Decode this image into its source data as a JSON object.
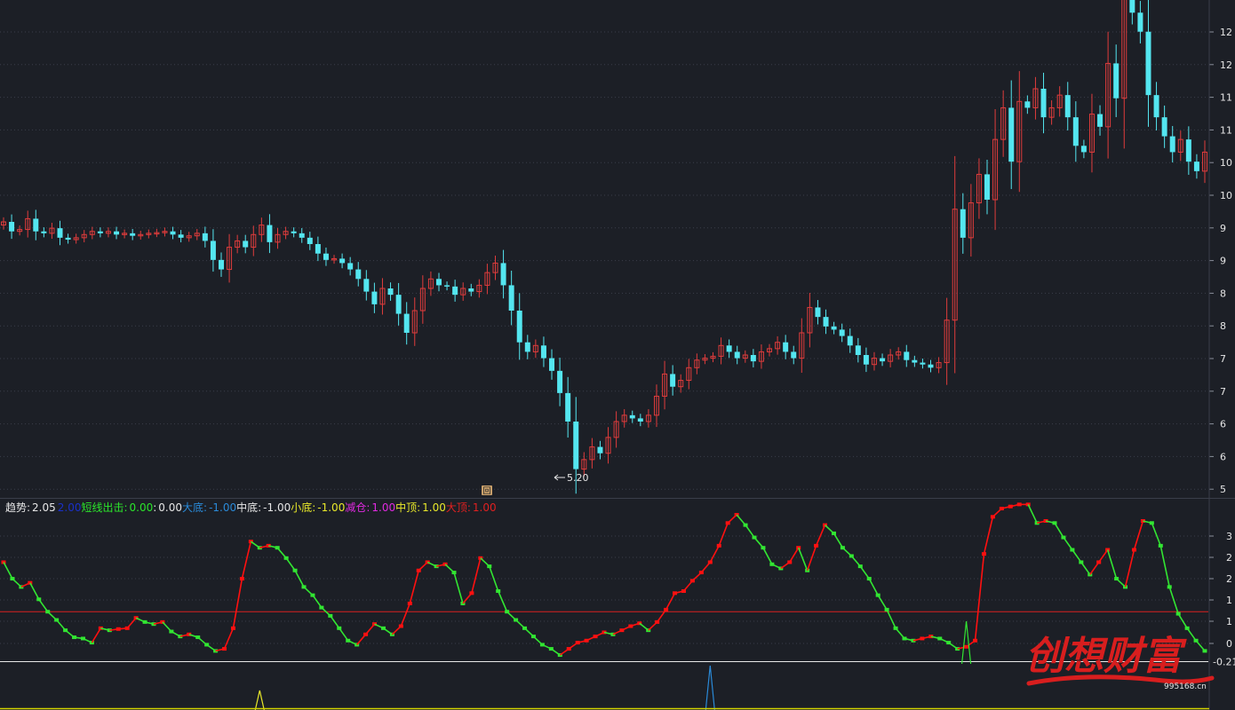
{
  "price_axis": {
    "ticks": [
      "12",
      "12",
      "11",
      "11",
      "10",
      "10",
      "9",
      "9",
      "8",
      "8",
      "7",
      "7",
      "6",
      "6",
      "5"
    ]
  },
  "low_marker": "5.20",
  "marker_glyph": "回",
  "indicator_bar": [
    {
      "label": "趋势:",
      "value": "2.05",
      "label_color": "#e6e6e6",
      "value_color": "#e6e6e6"
    },
    {
      "label": "",
      "value": "2.00",
      "label_color": "#1a30c8",
      "value_color": "#1a30c8"
    },
    {
      "label": "短线出击:",
      "value": "0.00",
      "label_color": "#2be52b",
      "value_color": "#2be52b"
    },
    {
      "label": ":",
      "value": "0.00",
      "label_color": "#e6e6e6",
      "value_color": "#e6e6e6"
    },
    {
      "label": "大底:",
      "value": "-1.00",
      "label_color": "#2a8ad8",
      "value_color": "#2a8ad8"
    },
    {
      "label": "中底:",
      "value": "-1.00",
      "label_color": "#e6e6e6",
      "value_color": "#e6e6e6"
    },
    {
      "label": "小底:",
      "value": "-1.00",
      "label_color": "#e8e82a",
      "value_color": "#e8e82a"
    },
    {
      "label": "减仓:",
      "value": "1.00",
      "label_color": "#e02ae0",
      "value_color": "#e02ae0"
    },
    {
      "label": "中顶:",
      "value": "1.00",
      "label_color": "#e8e82a",
      "value_color": "#e8e82a"
    },
    {
      "label": "大顶:",
      "value": "1.00",
      "label_color": "#e02020",
      "value_color": "#e02020"
    }
  ],
  "indicator_axis": {
    "ticks": [
      "3",
      "2",
      "2",
      "1",
      "1",
      "0"
    ],
    "current_value": "-0.21"
  },
  "watermark": {
    "text": "创想财富",
    "site": "995168.cn"
  },
  "colors": {
    "background": "#1c1f26",
    "up": "#e03c3c",
    "down": "#54e6f0",
    "rising": "#ff1010",
    "falling": "#32e632",
    "refline": "#d92020",
    "zeroline": "#e8e8e8",
    "grid": "#3a3e4a"
  },
  "chart_data": [
    {
      "type": "candlestick",
      "ylim": [
        4.9,
        12.6
      ],
      "close": [
        9.1,
        8.95,
        8.98,
        9.15,
        8.95,
        8.92,
        9.0,
        8.85,
        8.82,
        8.85,
        8.9,
        8.95,
        8.92,
        8.95,
        8.9,
        8.92,
        8.88,
        8.9,
        8.92,
        8.93,
        8.95,
        8.9,
        8.85,
        8.88,
        8.92,
        8.8,
        8.5,
        8.35,
        8.7,
        8.8,
        8.7,
        8.9,
        9.05,
        8.78,
        8.9,
        8.95,
        8.92,
        8.85,
        8.75,
        8.6,
        8.5,
        8.52,
        8.45,
        8.35,
        8.2,
        8.0,
        7.8,
        8.05,
        7.95,
        7.65,
        7.35,
        7.7,
        8.05,
        8.2,
        8.1,
        8.08,
        7.95,
        8.05,
        8.0,
        8.1,
        8.3,
        8.45,
        8.1,
        7.7,
        7.2,
        7.05,
        7.15,
        6.95,
        6.75,
        6.4,
        5.95,
        5.2,
        5.35,
        5.55,
        5.45,
        5.7,
        5.95,
        6.05,
        6.0,
        5.95,
        6.05,
        6.35,
        6.7,
        6.5,
        6.6,
        6.8,
        6.92,
        6.95,
        6.98,
        7.15,
        7.05,
        6.95,
        7.0,
        6.9,
        7.05,
        7.1,
        7.2,
        7.05,
        6.95,
        7.35,
        7.75,
        7.6,
        7.45,
        7.4,
        7.3,
        7.15,
        7.0,
        6.85,
        6.95,
        6.9,
        7.0,
        7.05,
        6.92,
        6.88,
        6.85,
        6.8,
        6.88,
        7.55,
        9.3,
        8.85,
        9.4,
        9.85,
        9.45,
        10.4,
        10.9,
        10.05,
        11.0,
        10.9,
        11.2,
        10.75,
        10.9,
        11.1,
        10.75,
        10.3,
        10.2,
        10.8,
        10.6,
        11.6,
        11.05,
        12.7,
        12.4,
        12.1,
        11.1,
        10.75,
        10.45,
        10.2,
        10.4,
        10.05,
        9.9,
        10.2
      ]
    },
    {
      "type": "line",
      "name": "趋势",
      "ylim": [
        -0.35,
        3.35
      ],
      "current": 2.05,
      "reference_lines": [
        1.0,
        -0.21
      ],
      "values": [
        2.2,
        1.8,
        1.6,
        1.7,
        1.3,
        1.0,
        0.8,
        0.55,
        0.38,
        0.35,
        0.25,
        0.6,
        0.55,
        0.58,
        0.6,
        0.85,
        0.75,
        0.7,
        0.75,
        0.52,
        0.4,
        0.45,
        0.38,
        0.2,
        0.05,
        0.1,
        0.6,
        1.8,
        2.7,
        2.55,
        2.6,
        2.55,
        2.3,
        2.0,
        1.6,
        1.4,
        1.1,
        0.9,
        0.6,
        0.3,
        0.2,
        0.45,
        0.7,
        0.6,
        0.45,
        0.65,
        1.2,
        2.0,
        2.2,
        2.1,
        2.15,
        1.95,
        1.2,
        1.45,
        2.3,
        2.1,
        1.5,
        1.0,
        0.8,
        0.6,
        0.4,
        0.2,
        0.1,
        -0.05,
        0.1,
        0.25,
        0.3,
        0.4,
        0.5,
        0.45,
        0.55,
        0.65,
        0.72,
        0.55,
        0.75,
        1.05,
        1.45,
        1.5,
        1.75,
        1.95,
        2.2,
        2.6,
        3.15,
        3.35,
        3.1,
        2.8,
        2.55,
        2.15,
        2.05,
        2.2,
        2.55,
        2.0,
        2.6,
        3.1,
        2.9,
        2.55,
        2.35,
        2.1,
        1.8,
        1.4,
        1.05,
        0.6,
        0.35,
        0.3,
        0.35,
        0.4,
        0.35,
        0.25,
        0.1,
        0.15,
        0.3,
        2.4,
        3.3,
        3.5,
        3.55,
        3.6,
        3.6,
        3.15,
        3.2,
        3.15,
        2.8,
        2.5,
        2.2,
        1.9,
        2.2,
        2.5,
        1.8,
        1.6,
        2.5,
        3.2,
        3.15,
        2.6,
        1.6,
        0.95,
        0.6,
        0.3,
        0.05
      ]
    }
  ]
}
